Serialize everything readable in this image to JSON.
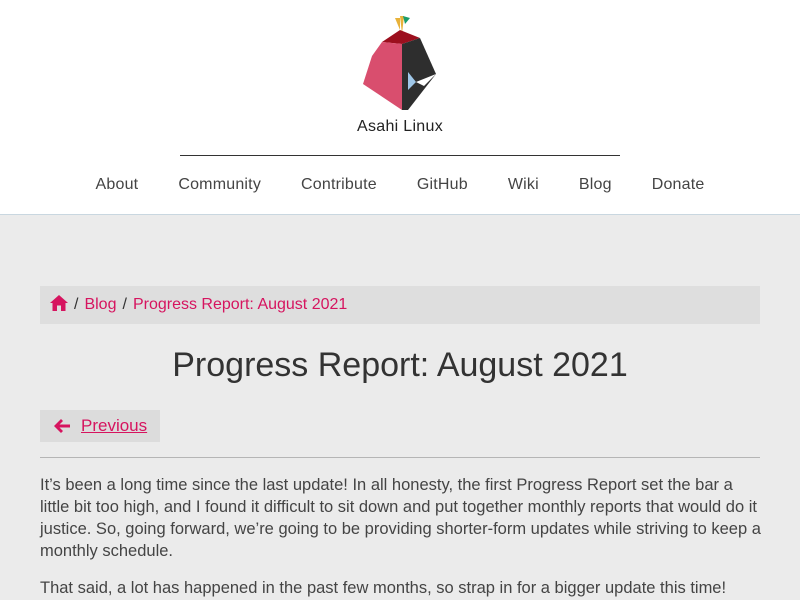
{
  "site": {
    "logo_text": "Asahi Linux",
    "accent_color": "#d6145f"
  },
  "nav": {
    "items": [
      {
        "label": "About"
      },
      {
        "label": "Community"
      },
      {
        "label": "Contribute"
      },
      {
        "label": "GitHub"
      },
      {
        "label": "Wiki"
      },
      {
        "label": "Blog"
      },
      {
        "label": "Donate"
      }
    ]
  },
  "breadcrumb": {
    "home_icon": "home-icon",
    "sep": "/",
    "blog": "Blog",
    "current": "Progress Report: August 2021"
  },
  "page": {
    "title": "Progress Report: August 2021"
  },
  "pager": {
    "icon": "arrow-left-icon",
    "previous_label": "Previous"
  },
  "content": {
    "paragraphs": [
      "It’s been a long time since the last update! In all honesty, the first Progress Report set the bar a little bit too high, and I found it difficult to sit down and put together monthly reports that would do it justice. So, going forward, we’re going to be providing shorter-form updates while striving to keep a monthly schedule.",
      "That said, a lot has happened in the past few months, so strap in for a bigger update this time!"
    ]
  }
}
